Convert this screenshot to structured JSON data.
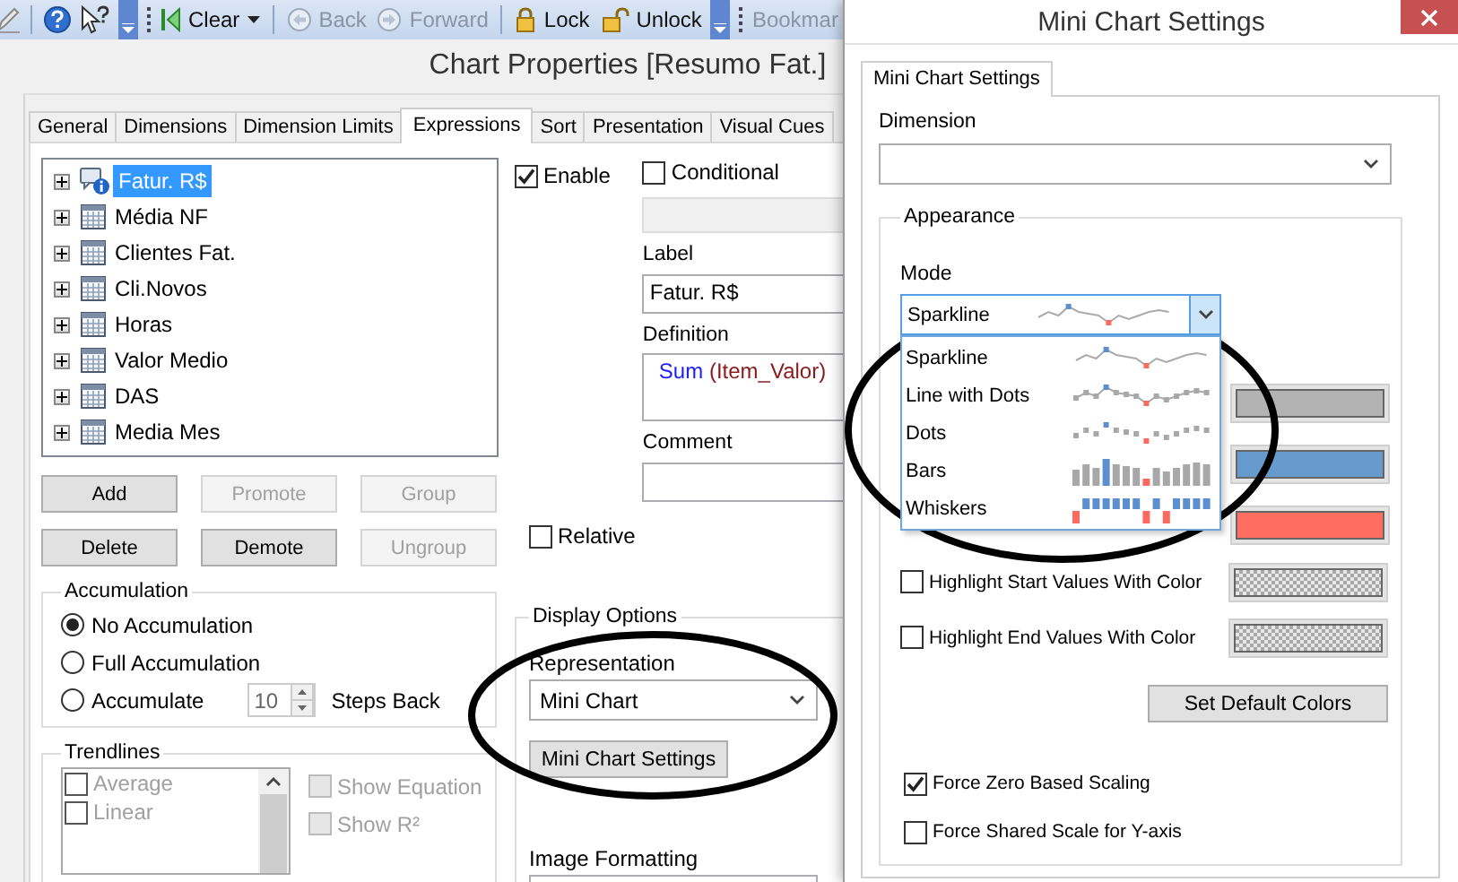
{
  "toolbar": [
    {
      "kind": "pencil"
    },
    {
      "kind": "separator"
    },
    {
      "kind": "help"
    },
    {
      "kind": "whatsthis"
    },
    {
      "kind": "overflow"
    },
    {
      "kind": "grip"
    },
    {
      "kind": "clear",
      "label": "Clear",
      "disabled": false
    },
    {
      "kind": "separator"
    },
    {
      "kind": "back",
      "label": "Back",
      "disabled": true
    },
    {
      "kind": "forward",
      "label": "Forward",
      "disabled": true
    },
    {
      "kind": "separator"
    },
    {
      "kind": "lock",
      "label": "Lock",
      "disabled": false
    },
    {
      "kind": "unlock",
      "label": "Unlock",
      "disabled": false
    },
    {
      "kind": "overflow"
    },
    {
      "kind": "grip"
    },
    {
      "kind": "bookmark",
      "label": "Bookmar",
      "disabled": true
    }
  ],
  "chart_properties": {
    "title": "Chart Properties [Resumo Fat.]",
    "tabs": [
      {
        "label": "General",
        "selected": false
      },
      {
        "label": "Dimensions",
        "selected": false
      },
      {
        "label": "Dimension Limits",
        "selected": false
      },
      {
        "label": "Expressions",
        "selected": true
      },
      {
        "label": "Sort",
        "selected": false
      },
      {
        "label": "Presentation",
        "selected": false
      },
      {
        "label": "Visual Cues",
        "selected": false
      }
    ],
    "expressions": [
      {
        "label": "Fatur. R$",
        "kind": "minichart",
        "expanded": false,
        "selected": true
      },
      {
        "label": "Média NF",
        "kind": "table",
        "expanded": false,
        "selected": false
      },
      {
        "label": "Clientes Fat.",
        "kind": "table",
        "expanded": false,
        "selected": false
      },
      {
        "label": "Cli.Novos",
        "kind": "table",
        "expanded": false,
        "selected": false
      },
      {
        "label": "Horas",
        "kind": "table",
        "expanded": false,
        "selected": false
      },
      {
        "label": "Valor Medio",
        "kind": "table",
        "expanded": false,
        "selected": false
      },
      {
        "label": "DAS",
        "kind": "table",
        "expanded": false,
        "selected": false
      },
      {
        "label": "Media Mes",
        "kind": "table",
        "expanded": false,
        "selected": false
      }
    ],
    "buttons": [
      {
        "label": "Add",
        "disabled": false
      },
      {
        "label": "Promote",
        "disabled": true
      },
      {
        "label": "Group",
        "disabled": true
      },
      {
        "label": "Delete",
        "disabled": false
      },
      {
        "label": "Demote",
        "disabled": false
      },
      {
        "label": "Ungroup",
        "disabled": true
      }
    ],
    "accumulation": {
      "title": "Accumulation",
      "options": [
        {
          "label": "No Accumulation",
          "selected": true
        },
        {
          "label": "Full Accumulation",
          "selected": false
        },
        {
          "label": "Accumulate",
          "selected": false
        }
      ],
      "steps": "10",
      "steps_label": "Steps Back"
    },
    "trendlines": {
      "title": "Trendlines",
      "items": [
        {
          "label": "Average",
          "checked": false,
          "disabled": true
        },
        {
          "label": "Linear",
          "checked": false,
          "disabled": true
        }
      ],
      "options": [
        {
          "label": "Show Equation",
          "checked": false,
          "disabled": true
        },
        {
          "label": "Show R²",
          "checked": false,
          "disabled": true
        }
      ]
    },
    "enable": {
      "label": "Enable",
      "checked": true
    },
    "conditional": {
      "label": "Conditional",
      "checked": false
    },
    "label_caption": "Label",
    "label_value": "Fatur. R$",
    "definition_caption": "Definition",
    "definition": [
      {
        "kind": "function",
        "text": "Sum"
      },
      {
        "kind": "field",
        "text": " (Item_Valor)"
      }
    ],
    "comment_caption": "Comment",
    "relative": {
      "label": "Relative",
      "checked": false
    },
    "display_options": {
      "title": "Display Options",
      "representation_caption": "Representation",
      "representation": "Mini Chart",
      "settings_button": "Mini Chart Settings",
      "image_formatting_caption": "Image Formatting"
    }
  },
  "mini_chart_settings": {
    "title": "Mini Chart Settings",
    "tabs": [
      {
        "label": "Mini Chart Settings",
        "selected": true
      }
    ],
    "dimension_caption": "Dimension",
    "appearance_title": "Appearance",
    "mode_caption": "Mode",
    "mode": {
      "label": "Sparkline",
      "kind": "sparkline"
    },
    "mode_options": [
      {
        "label": "Sparkline",
        "kind": "sparkline",
        "selected": false
      },
      {
        "label": "Line with Dots",
        "kind": "linedots",
        "selected": false
      },
      {
        "label": "Dots",
        "kind": "dots",
        "selected": false
      },
      {
        "label": "Bars",
        "kind": "bars",
        "selected": false
      },
      {
        "label": "Whiskers",
        "kind": "whiskers",
        "selected": false
      }
    ],
    "color_swatches": [
      {
        "color": "#b3b3b3"
      },
      {
        "color": "#6699cc"
      },
      {
        "color": "#ff6e61"
      }
    ],
    "highlights": [
      {
        "label": "Highlight Start Values With Color",
        "checked": false
      },
      {
        "label": "Highlight End Values With Color",
        "checked": false
      }
    ],
    "default_colors_button": "Set Default Colors",
    "scaling": [
      {
        "label": "Force Zero Based Scaling",
        "checked": true
      },
      {
        "label": "Force Shared Scale for Y-axis",
        "checked": false
      }
    ]
  }
}
